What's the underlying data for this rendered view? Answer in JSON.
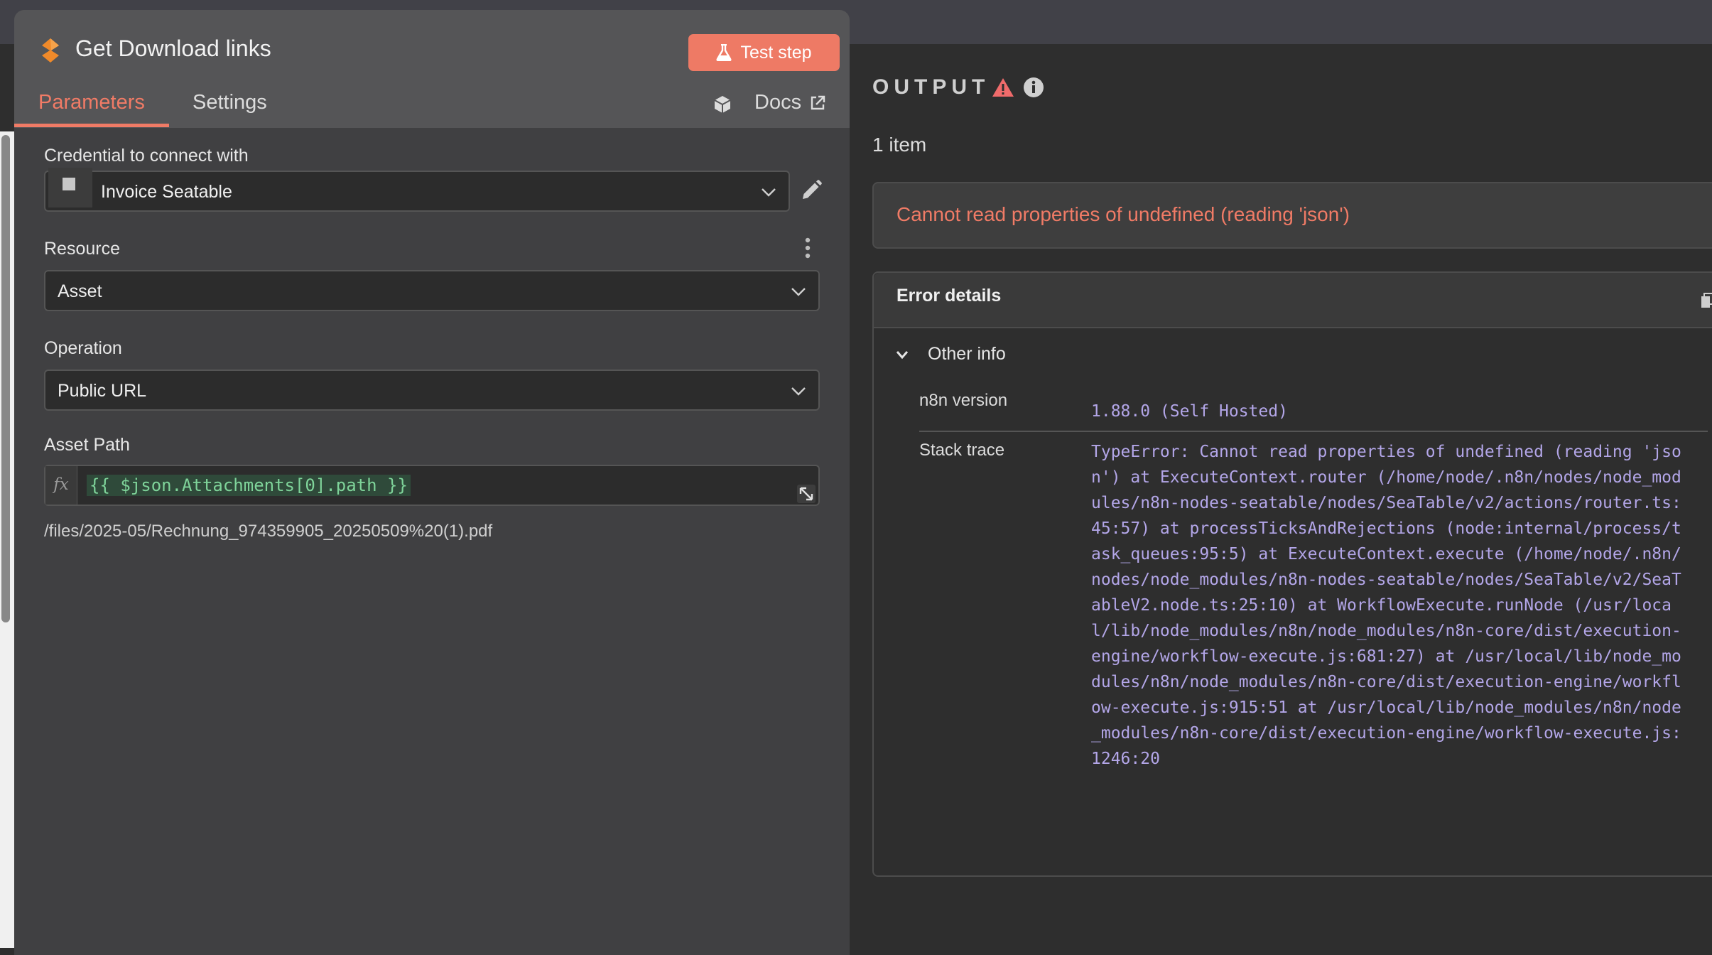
{
  "panel": {
    "title": "Get Download links",
    "test_button": "Test step",
    "tabs": [
      {
        "label": "Parameters",
        "active": true
      },
      {
        "label": "Settings",
        "active": false
      }
    ],
    "docs_label": "Docs"
  },
  "fields": {
    "credential": {
      "label": "Credential to connect with",
      "value": "Invoice Seatable"
    },
    "resource": {
      "label": "Resource",
      "value": "Asset"
    },
    "operation": {
      "label": "Operation",
      "value": "Public URL"
    },
    "asset_path": {
      "label": "Asset Path",
      "fx": "fx",
      "expression": "{{ $json.Attachments[0].path }}",
      "result": "/files/2025-05/Rechnung_974359905_20250509%20(1).pdf"
    }
  },
  "output": {
    "title": "OUTPUT",
    "item_count": "1 item",
    "error_message": "Cannot read properties of undefined (reading 'json')",
    "details_title": "Error details",
    "other_info_label": "Other info",
    "version_label": "n8n version",
    "version_value": "1.88.0 (Self Hosted)",
    "stack_label": "Stack trace",
    "stack_value": "TypeError: Cannot read properties of undefined (reading 'json') at ExecuteContext.router (/home/node/.n8n/nodes/node_modules/n8n-nodes-seatable/nodes/SeaTable/v2/actions/router.ts:45:57) at processTicksAndRejections (node:internal/process/task_queues:95:5) at ExecuteContext.execute (/home/node/.n8n/nodes/node_modules/n8n-nodes-seatable/nodes/SeaTable/v2/SeaTableV2.node.ts:25:10) at WorkflowExecute.runNode (/usr/local/lib/node_modules/n8n/node_modules/n8n-core/dist/execution-engine/workflow-execute.js:681:27) at /usr/local/lib/node_modules/n8n/node_modules/n8n-core/dist/execution-engine/workflow-execute.js:915:51 at /usr/local/lib/node_modules/n8n/node_modules/n8n-core/dist/execution-engine/workflow-execute.js:1246:20"
  },
  "colors": {
    "accent": "#f07b66",
    "button": "#ee7a65",
    "panel_bg": "#404042",
    "header_bg": "#555557",
    "code_purple": "#b3a6e8",
    "expression_green": "#7fd49a"
  },
  "icons": [
    "seatable-node-icon",
    "flask-icon",
    "cube-icon",
    "external-link-icon",
    "chevron-down-icon",
    "pencil-icon",
    "vertical-dots-icon",
    "expand-icon",
    "warning-icon",
    "info-icon",
    "copy-icon"
  ]
}
